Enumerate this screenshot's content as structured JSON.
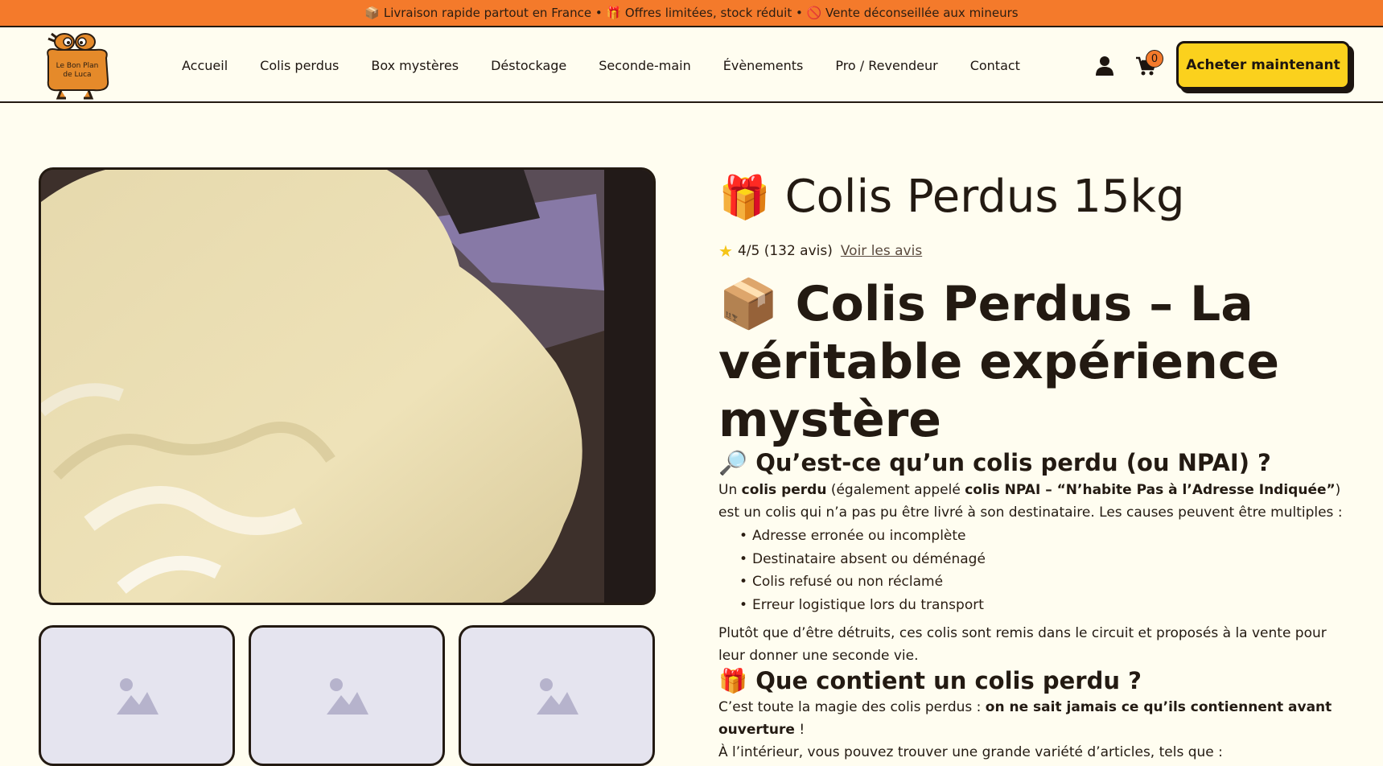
{
  "topbar": {
    "text": "📦 Livraison rapide partout en France • 🎁 Offres limitées, stock réduit • 🚫 Vente déconseillée aux mineurs"
  },
  "logo": {
    "line1": "Le Bon Plan",
    "line2": "de Luca"
  },
  "nav": [
    "Accueil",
    "Colis perdus",
    "Box mystères",
    "Déstockage",
    "Seconde-main",
    "Évènements",
    "Pro / Revendeur",
    "Contact"
  ],
  "cart": {
    "count": "0"
  },
  "header": {
    "buy_label": "Acheter maintenant"
  },
  "product": {
    "title_emoji": "🎁",
    "title": "Colis Perdus 15kg",
    "rating_text": "4/5 (132 avis)",
    "reviews_link": "Voir les avis",
    "headline_emoji": "📦",
    "headline": "Colis Perdus – La véritable expérience mystère"
  },
  "section1": {
    "heading": "🔎 Qu’est-ce qu’un colis perdu (ou NPAI) ?",
    "p_a": "Un ",
    "p_b": "colis perdu",
    "p_c": " (également appelé ",
    "p_d": "colis NPAI – “N’habite Pas à l’Adresse Indiquée”",
    "p_e": ") est un colis qui n’a pas pu être livré à son destinataire. Les causes peuvent être multiples :",
    "bullets": [
      "Adresse erronée ou incomplète",
      "Destinataire absent ou déménagé",
      "Colis refusé ou non réclamé",
      "Erreur logistique lors du transport"
    ],
    "after": "Plutôt que d’être détruits, ces colis sont remis dans le circuit et proposés à la vente pour leur donner une seconde vie."
  },
  "section2": {
    "heading": "🎁 Que contient un colis perdu ?",
    "p_a": "C’est toute la magie des colis perdus : ",
    "p_b": "on ne sait jamais ce qu’ils contiennent avant ouverture",
    "p_c": " !",
    "p2": "À l’intérieur, vous pouvez trouver une grande variété d’articles, tels que :"
  },
  "colors": {
    "topbar": "#f47a2b",
    "accent_button": "#fbd11d",
    "background": "#fffdf0",
    "ink": "#231a12"
  },
  "icons": [
    "user-icon",
    "cart-icon",
    "star-icon",
    "image-placeholder-icon"
  ]
}
